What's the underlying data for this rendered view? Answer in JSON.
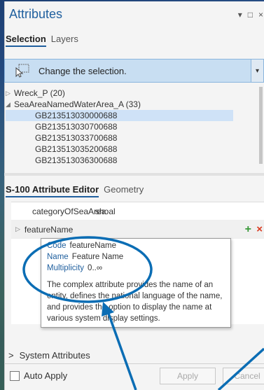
{
  "titlebar": {
    "title": "Attributes",
    "controls": [
      "▾",
      "□",
      "×"
    ]
  },
  "top_tabs": [
    "Selection",
    "Layers"
  ],
  "selection_bar": {
    "label": "Change the selection.",
    "dropdown_glyph": "▾"
  },
  "tree": {
    "nodes": [
      {
        "arrow": "▷",
        "label": "Wreck_P (20)"
      },
      {
        "arrow": "◢",
        "label": "SeaAreaNamedWaterArea_A (33)"
      }
    ],
    "features": [
      "GB213513030000688",
      "GB213513030700688",
      "GB213513033700688",
      "GB213513035200688",
      "GB213513036300688"
    ]
  },
  "editor_tabs": [
    "S-100 Attribute Editor",
    "Geometry"
  ],
  "attributes": [
    {
      "name": "categoryOfSeaArea",
      "value": "shoal"
    },
    {
      "name": "featureName",
      "value": ""
    }
  ],
  "row_actions": {
    "add": "+",
    "remove": "×"
  },
  "tooltip": {
    "rows": [
      {
        "key": "Code",
        "value": "featureName"
      },
      {
        "key": "Name",
        "value": "Feature Name"
      },
      {
        "key": "Multiplicity",
        "value": "0..∞"
      }
    ],
    "description": "The complex attribute provides the name of an entity, defines the national language of the name, and provides the option to display the name at various system display settings."
  },
  "system_attributes": {
    "label": "System Attributes",
    "arrow": ">"
  },
  "auto_apply": {
    "label": "Auto Apply"
  },
  "buttons": {
    "apply": "Apply",
    "cancel": "Cancel"
  },
  "colors": {
    "accent": "#1f5f9e",
    "annotation": "#0b6db4",
    "selection": "#cfe2f7"
  }
}
